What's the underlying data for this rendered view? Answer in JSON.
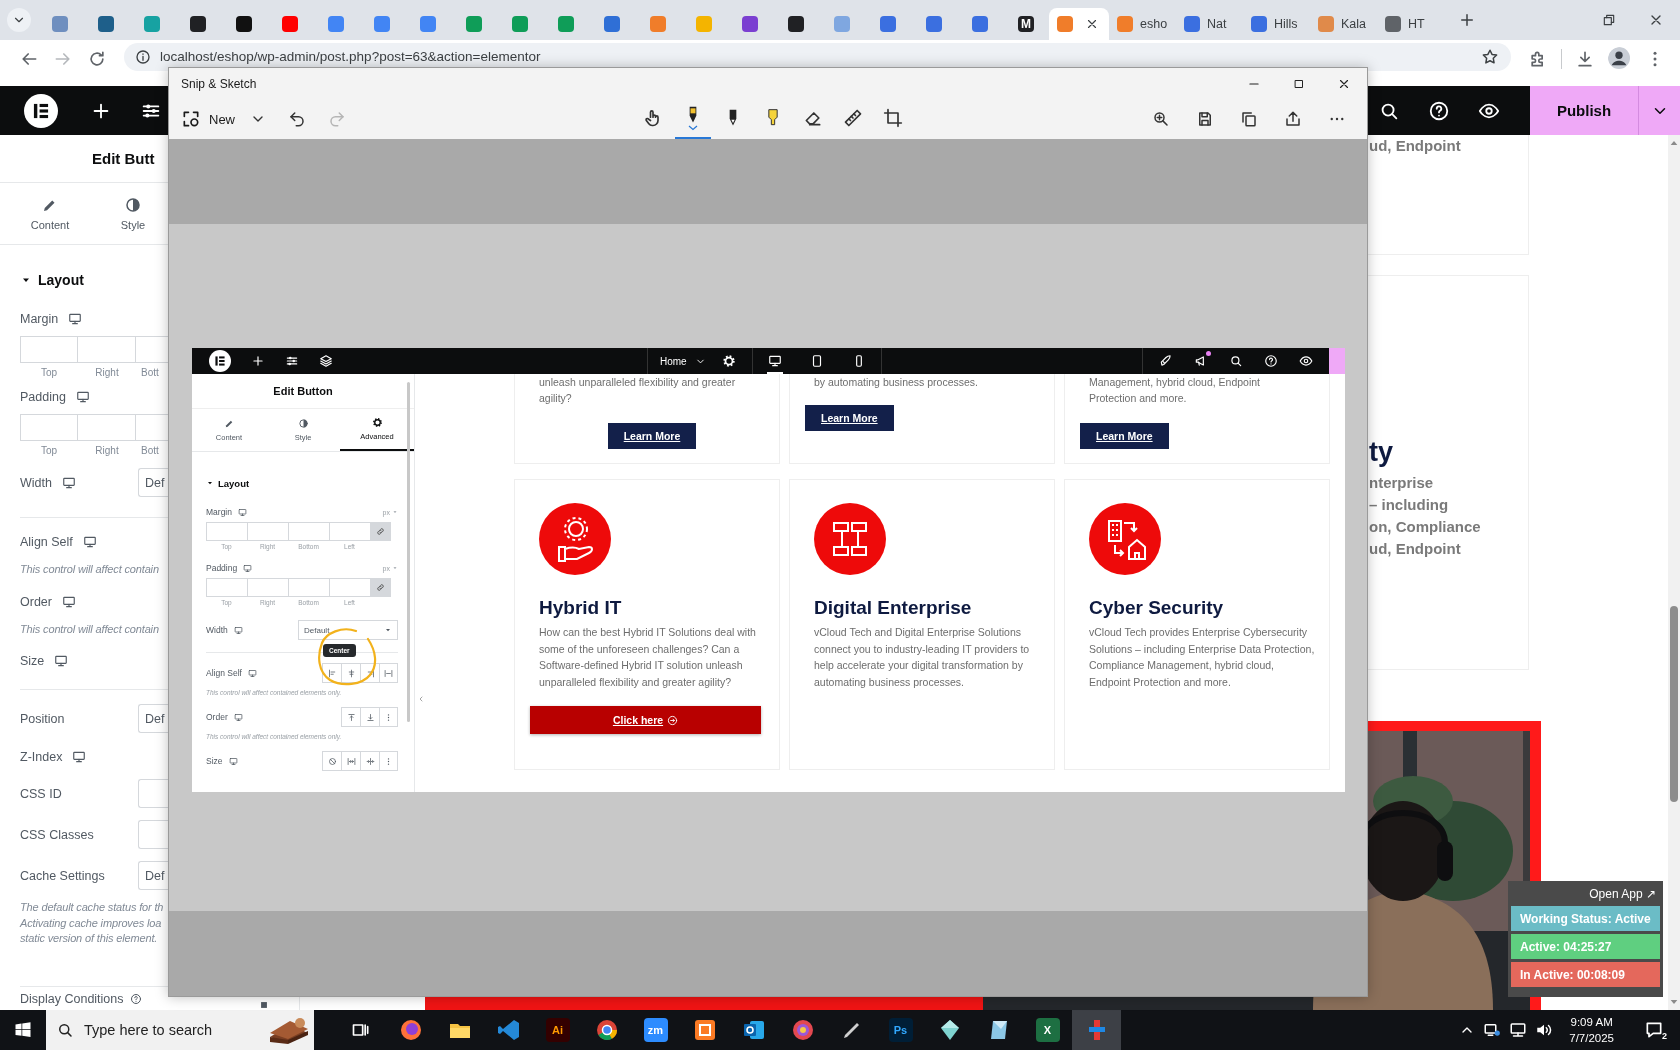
{
  "browser": {
    "tabs": [
      {
        "selected": false,
        "color": "#6f8fbf"
      },
      {
        "selected": false,
        "color": "#1e5f8a"
      },
      {
        "selected": false,
        "color": "#17a2a2"
      },
      {
        "selected": false,
        "color": "#202124"
      },
      {
        "selected": false,
        "color": "#111111"
      },
      {
        "selected": false,
        "color": "#ff0000"
      },
      {
        "selected": false,
        "color": "#4285f4"
      },
      {
        "selected": false,
        "color": "#4285f4"
      },
      {
        "selected": false,
        "color": "#4285f4"
      },
      {
        "selected": false,
        "color": "#0f9d58"
      },
      {
        "selected": false,
        "color": "#0f9d58"
      },
      {
        "selected": false,
        "color": "#0f9d58"
      },
      {
        "selected": false,
        "color": "#2f6fd6"
      },
      {
        "selected": false,
        "color": "#f07d2a"
      },
      {
        "selected": false,
        "color": "#f4b400"
      },
      {
        "selected": false,
        "color": "#7b3fd1"
      },
      {
        "selected": false,
        "color": "#202124"
      },
      {
        "selected": false,
        "color": "#7fa7e0"
      },
      {
        "selected": false,
        "color": "#3b6fe0"
      },
      {
        "selected": false,
        "color": "#3b6fe0"
      },
      {
        "selected": false,
        "color": "#3b6fe0"
      },
      {
        "selected": false,
        "color": "#202124",
        "glyph": "M"
      },
      {
        "selected": true,
        "color": "#f07d2a"
      },
      {
        "label": "esho",
        "selected": false,
        "color": "#f07d2a"
      },
      {
        "label": "Nat",
        "selected": false,
        "color": "#3b6fe0"
      },
      {
        "label": "Hills",
        "selected": false,
        "color": "#3b6fe0"
      },
      {
        "label": "Kala",
        "selected": false,
        "color": "#e08a4a"
      },
      {
        "label": "HT",
        "selected": false,
        "color": "#5f6368"
      }
    ],
    "address": "localhost/eshop/wp-admin/post.php?post=63&action=elementor"
  },
  "editor": {
    "publish": "Publish",
    "panel": {
      "title": "Edit Butt",
      "tabs": [
        {
          "label": "Content",
          "selected": false
        },
        {
          "label": "Style",
          "selected": false
        }
      ],
      "section": "Layout",
      "controls": [
        {
          "kind": "sides",
          "label": "Margin",
          "responsive": true,
          "separated": false,
          "sides": [
            "Top",
            "Right",
            "Bott"
          ]
        },
        {
          "kind": "sides",
          "label": "Padding",
          "responsive": true,
          "separated": false,
          "sides": [
            "Top",
            "Right",
            "Bott"
          ]
        },
        {
          "kind": "select",
          "label": "Width",
          "responsive": true,
          "separated": false,
          "value": "Def"
        },
        {
          "kind": "plain",
          "label": "Align Self",
          "responsive": true,
          "separated": true,
          "note": [
            "This control will affect contain"
          ]
        },
        {
          "kind": "plain",
          "label": "Order",
          "responsive": true,
          "separated": false,
          "note": [
            "This control will affect contain"
          ]
        },
        {
          "kind": "plain",
          "label": "Size",
          "responsive": true,
          "separated": false
        },
        {
          "kind": "select",
          "label": "Position",
          "responsive": false,
          "separated": true,
          "value": "Def"
        },
        {
          "kind": "plain",
          "label": "Z-Index",
          "responsive": true,
          "separated": false
        },
        {
          "kind": "input",
          "label": "CSS ID",
          "responsive": false,
          "separated": false
        },
        {
          "kind": "input",
          "label": "CSS Classes",
          "responsive": false,
          "separated": false
        },
        {
          "kind": "select",
          "label": "Cache Settings",
          "responsive": false,
          "separated": false,
          "value": "Def",
          "note": [
            "The default cache status for th",
            "Activating cache improves loa",
            "static version of this element."
          ]
        }
      ],
      "footer": "Display Conditions"
    },
    "canvas": {
      "fragment": "ud, Endpoint",
      "card": {
        "title": "ty",
        "lines": [
          "nterprise",
          "– including",
          "on, Compliance",
          "ud, Endpoint"
        ]
      }
    }
  },
  "snip": {
    "title": "Snip & Sketch",
    "new": "New",
    "history": [
      {
        "disabled": false
      },
      {
        "disabled": true
      }
    ],
    "tools": [
      {
        "selected": false
      },
      {
        "selected": true
      },
      {
        "selected": false
      },
      {
        "selected": false
      },
      {
        "selected": false
      },
      {
        "selected": false
      },
      {
        "selected": false
      }
    ],
    "shot": {
      "page": "Home",
      "devices": [
        {
          "selected": true
        },
        {
          "selected": false
        },
        {
          "selected": false
        }
      ],
      "panel": {
        "title": "Edit Button",
        "tabs": [
          {
            "label": "Content",
            "selected": false
          },
          {
            "label": "Style",
            "selected": false
          },
          {
            "label": "Advanced",
            "selected": true
          }
        ],
        "section": "Layout",
        "spacing": [
          {
            "label": "Margin",
            "unit": "px",
            "sides": [
              "Top",
              "Right",
              "Bottom",
              "Left"
            ]
          },
          {
            "label": "Padding",
            "unit": "px",
            "sides": [
              "Top",
              "Right",
              "Bottom",
              "Left"
            ]
          }
        ],
        "width": {
          "label": "Width",
          "value": "Default"
        },
        "align": {
          "label": "Align Self",
          "tooltip": "Center",
          "note": "This control will affect contained elements only."
        },
        "order": {
          "label": "Order",
          "note": "This control will affect contained elements only."
        },
        "size": {
          "label": "Size"
        }
      },
      "top_cards": [
        {
          "lines": [
            "unleash unparalleled flexibility and greater",
            "agility?"
          ],
          "button": "Learn More",
          "button_centered": true
        },
        {
          "lines": [
            "by automating business processes."
          ],
          "button": "Learn More",
          "button_centered": false
        },
        {
          "lines": [
            "Management, hybrid cloud, Endpoint",
            "Protection and more."
          ],
          "button": "Learn More",
          "button_centered": false
        }
      ],
      "cards": [
        {
          "title": "Hybrid IT",
          "text": "How can the best Hybrid IT Solutions deal with some of the unforeseen challenges? Can a Software-defined Hybrid IT solution unleash unparalleled flexibility and greater agility?",
          "button": "Click here"
        },
        {
          "title": "Digital Enterprise",
          "text": "vCloud Tech and Digital Enterprise Solutions connect you to industry-leading IT providers to help accelerate your digital transformation by automating business processes."
        },
        {
          "title": "Cyber Security",
          "text": "vCloud Tech provides Enterprise Cybersecurity Solutions – including Enterprise Data Protection, Compliance Management, hybrid cloud, Endpoint Protection and more."
        }
      ]
    }
  },
  "widget": {
    "link": "Open App ↗",
    "rows": [
      {
        "text": "Working Status: Active",
        "color": "#6bbcc6"
      },
      {
        "text": "Active: 04:25:27",
        "color": "#5fcf80"
      },
      {
        "text": "In Active: 00:08:09",
        "color": "#e4685c"
      }
    ]
  },
  "taskbar": {
    "search": "Type here to search",
    "apps": [
      {
        "selected": false
      },
      {
        "selected": false
      },
      {
        "selected": false
      },
      {
        "selected": false,
        "label": "Ai"
      },
      {
        "selected": false
      },
      {
        "selected": false,
        "label": "zm"
      },
      {
        "selected": false
      },
      {
        "selected": false
      },
      {
        "selected": false
      },
      {
        "selected": false
      },
      {
        "selected": false,
        "label": "Ps"
      },
      {
        "selected": false
      },
      {
        "selected": false
      },
      {
        "selected": false,
        "label": "X"
      },
      {
        "selected": true
      }
    ],
    "time": "9:09 AM",
    "date": "7/7/2025",
    "notifications": "2"
  }
}
